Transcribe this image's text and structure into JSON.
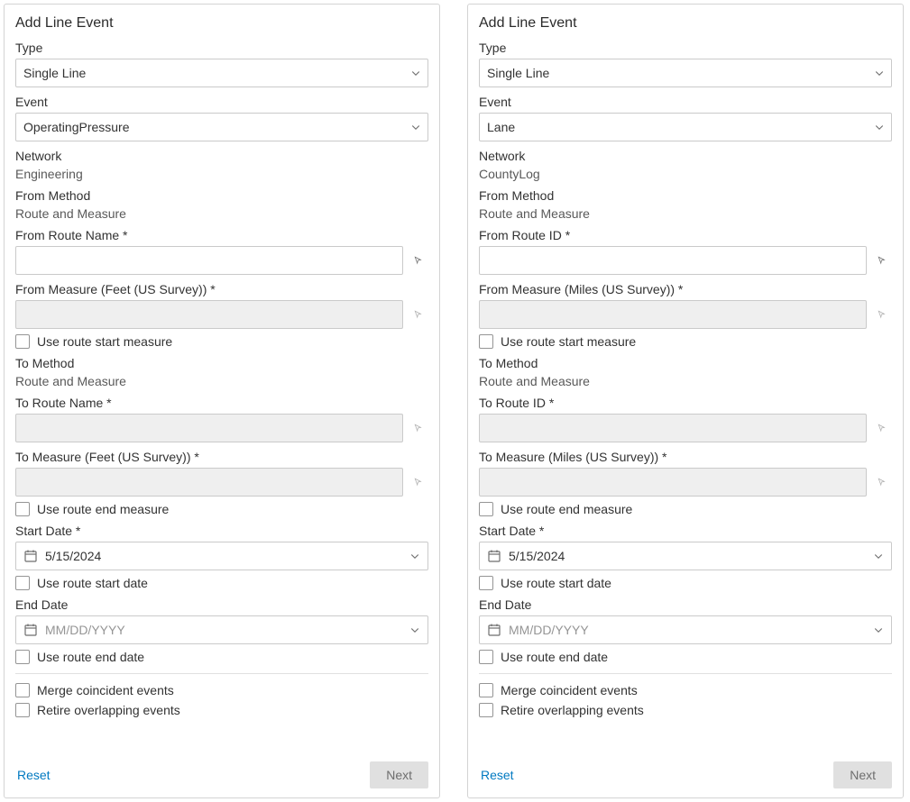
{
  "panels": [
    {
      "title": "Add Line Event",
      "type_label": "Type",
      "type_value": "Single Line",
      "event_label": "Event",
      "event_value": "OperatingPressure",
      "network_label": "Network",
      "network_value": "Engineering",
      "from_method_label": "From Method",
      "from_method_value": "Route and Measure",
      "from_route_label": "From Route Name *",
      "from_route_value": "",
      "from_measure_label": "From Measure (Feet (US Survey)) *",
      "from_measure_value": "",
      "use_route_start_measure": "Use route start measure",
      "to_method_label": "To Method",
      "to_method_value": "Route and Measure",
      "to_route_label": "To Route Name *",
      "to_route_value": "",
      "to_measure_label": "To Measure (Feet (US Survey)) *",
      "to_measure_value": "",
      "use_route_end_measure": "Use route end measure",
      "start_date_label": "Start Date *",
      "start_date_value": "5/15/2024",
      "use_route_start_date": "Use route start date",
      "end_date_label": "End Date",
      "end_date_placeholder": "MM/DD/YYYY",
      "use_route_end_date": "Use route end date",
      "merge_label": "Merge coincident events",
      "retire_label": "Retire overlapping events",
      "reset": "Reset",
      "next": "Next"
    },
    {
      "title": "Add Line Event",
      "type_label": "Type",
      "type_value": "Single Line",
      "event_label": "Event",
      "event_value": "Lane",
      "network_label": "Network",
      "network_value": "CountyLog",
      "from_method_label": "From Method",
      "from_method_value": "Route and Measure",
      "from_route_label": "From Route ID *",
      "from_route_value": "",
      "from_measure_label": "From Measure (Miles (US Survey)) *",
      "from_measure_value": "",
      "use_route_start_measure": "Use route start measure",
      "to_method_label": "To Method",
      "to_method_value": "Route and Measure",
      "to_route_label": "To Route ID *",
      "to_route_value": "",
      "to_measure_label": "To Measure (Miles (US Survey)) *",
      "to_measure_value": "",
      "use_route_end_measure": "Use route end measure",
      "start_date_label": "Start Date *",
      "start_date_value": "5/15/2024",
      "use_route_start_date": "Use route start date",
      "end_date_label": "End Date",
      "end_date_placeholder": "MM/DD/YYYY",
      "use_route_end_date": "Use route end date",
      "merge_label": "Merge coincident events",
      "retire_label": "Retire overlapping events",
      "reset": "Reset",
      "next": "Next"
    }
  ]
}
